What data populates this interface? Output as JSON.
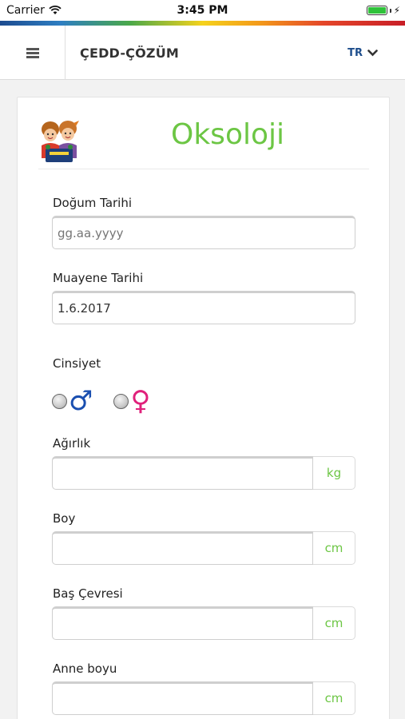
{
  "status_bar": {
    "carrier": "Carrier",
    "time": "3:45 PM",
    "battery_level": 1.0
  },
  "navbar": {
    "menu_icon": "hamburger-menu-icon",
    "brand": "ÇEDD-ÇÖZÜM",
    "language": "TR",
    "language_icon": "chevron-down-icon"
  },
  "page": {
    "title": "Oksoloji",
    "logo_icon": "children-logo-icon"
  },
  "form": {
    "birth_date": {
      "label": "Doğum Tarihi",
      "value": "",
      "placeholder": "gg.aa.yyyy"
    },
    "exam_date": {
      "label": "Muayene Tarihi",
      "value": "1.6.2017"
    },
    "gender": {
      "label": "Cinsiyet",
      "male_symbol": "♂",
      "female_symbol": "♀",
      "selected": null
    },
    "weight": {
      "label": "Ağırlık",
      "value": "",
      "unit": "kg"
    },
    "height": {
      "label": "Boy",
      "value": "",
      "unit": "cm"
    },
    "head_circumference": {
      "label": "Baş Çevresi",
      "value": "",
      "unit": "cm"
    },
    "mother_height": {
      "label": "Anne boyu",
      "value": "",
      "unit": "cm"
    }
  },
  "colors": {
    "accent_green": "#6cc644",
    "lang_blue": "#1e4e8c",
    "male_blue": "#1a4fb0",
    "female_pink": "#e0217b"
  }
}
